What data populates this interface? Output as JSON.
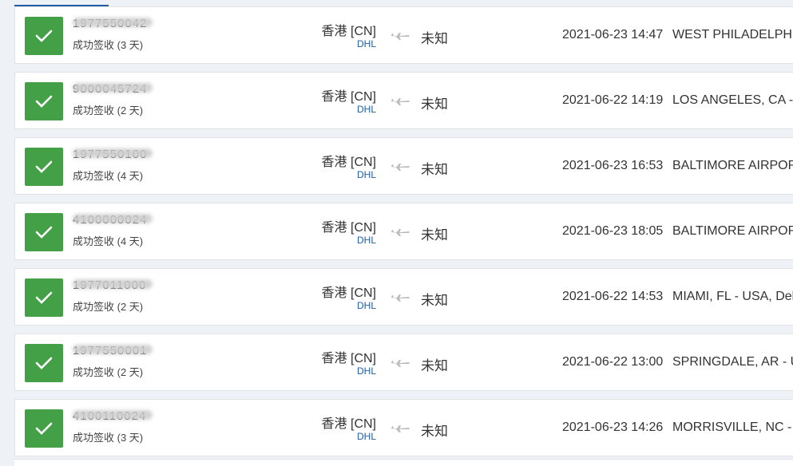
{
  "rows": [
    {
      "tracking": "1977550042",
      "status": "成功签收 (3 天)",
      "origin": "香港 [CN]",
      "carrier": "DHL",
      "destination": "未知",
      "time": "2021-06-23 14:47",
      "event": "WEST PHILADELPHIA"
    },
    {
      "tracking": "9000045724",
      "status": "成功签收 (2 天)",
      "origin": "香港 [CN]",
      "carrier": "DHL",
      "destination": "未知",
      "time": "2021-06-22 14:19",
      "event": "LOS ANGELES, CA - USA"
    },
    {
      "tracking": "1977550100",
      "status": "成功签收 (4 天)",
      "origin": "香港 [CN]",
      "carrier": "DHL",
      "destination": "未知",
      "time": "2021-06-23 16:53",
      "event": "BALTIMORE AIRPORT"
    },
    {
      "tracking": "4100000024",
      "status": "成功签收 (4 天)",
      "origin": "香港 [CN]",
      "carrier": "DHL",
      "destination": "未知",
      "time": "2021-06-23 18:05",
      "event": "BALTIMORE AIRPORT"
    },
    {
      "tracking": "1977011000",
      "status": "成功签收 (2 天)",
      "origin": "香港 [CN]",
      "carrier": "DHL",
      "destination": "未知",
      "time": "2021-06-22 14:53",
      "event": "MIAMI, FL - USA, Del"
    },
    {
      "tracking": "1977550001",
      "status": "成功签收 (2 天)",
      "origin": "香港 [CN]",
      "carrier": "DHL",
      "destination": "未知",
      "time": "2021-06-22 13:00",
      "event": "SPRINGDALE, AR - USA"
    },
    {
      "tracking": "4100110024",
      "status": "成功签收 (3 天)",
      "origin": "香港 [CN]",
      "carrier": "DHL",
      "destination": "未知",
      "time": "2021-06-23 14:26",
      "event": "MORRISVILLE, NC - USA"
    }
  ],
  "icons": {
    "status": "checkmark-icon",
    "transit": "airplane-icon"
  },
  "colors": {
    "success": "#43a047",
    "carrier_link": "#1f5ea8",
    "tab_accent": "#1f5ea8"
  }
}
